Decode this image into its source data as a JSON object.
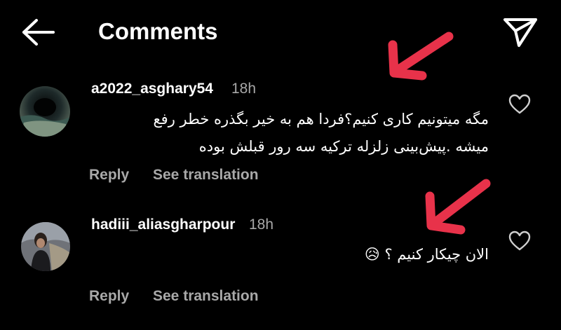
{
  "header": {
    "title": "Comments",
    "back_icon": "back-arrow-icon",
    "send_icon": "paper-plane-icon"
  },
  "comments": [
    {
      "username": "a2022_asghary54",
      "time": "18h",
      "lines": [
        "مگه میتونیم کاری کنیم؟فردا هم به خیر بگذره خطر  رفع",
        "میشه .پیش‌بینی زلزله ترکیه سه رور قبلش بوده"
      ],
      "reply_label": "Reply",
      "translate_label": "See translation",
      "liked": false
    },
    {
      "username": "hadiii_aliasgharpour",
      "time": "18h",
      "text": "الان چیکار کنیم ؟",
      "emoji": "😥",
      "reply_label": "Reply",
      "translate_label": "See translation",
      "liked": false
    }
  ],
  "colors": {
    "background": "#000000",
    "text": "#ffffff",
    "secondary": "#a8a8a8",
    "annotation_arrow": "#e8324a"
  }
}
